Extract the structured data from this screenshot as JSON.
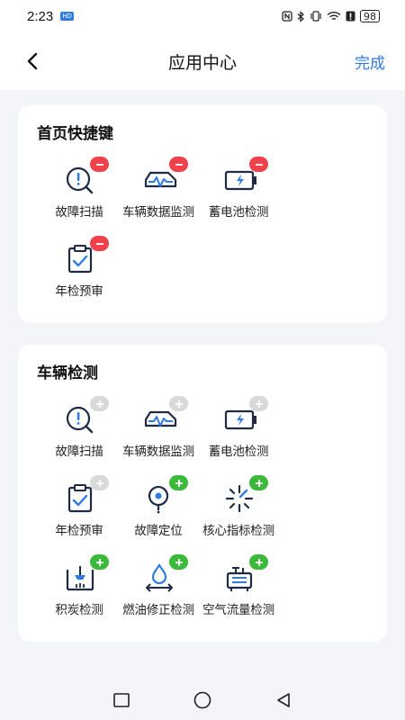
{
  "status_bar": {
    "time": "2:23",
    "hd_badge": "HD",
    "battery": "98"
  },
  "header": {
    "title": "应用中心",
    "done_label": "完成"
  },
  "shortcuts": {
    "title": "首页快捷键",
    "items": [
      {
        "label": "故障扫描",
        "icon": "fault-scan-icon",
        "action": "remove"
      },
      {
        "label": "车辆数据监测",
        "icon": "vehicle-data-icon",
        "action": "remove"
      },
      {
        "label": "蓄电池检测",
        "icon": "battery-test-icon",
        "action": "remove"
      },
      {
        "label": "年检预审",
        "icon": "inspection-icon",
        "action": "remove"
      }
    ]
  },
  "vehicle_test": {
    "title": "车辆检测",
    "items": [
      {
        "label": "故障扫描",
        "icon": "fault-scan-icon",
        "action": "added"
      },
      {
        "label": "车辆数据监测",
        "icon": "vehicle-data-icon",
        "action": "added"
      },
      {
        "label": "蓄电池检测",
        "icon": "battery-test-icon",
        "action": "added"
      },
      {
        "label": "年检预审",
        "icon": "inspection-icon",
        "action": "added"
      },
      {
        "label": "故障定位",
        "icon": "fault-locate-icon",
        "action": "add"
      },
      {
        "label": "核心指标检测",
        "icon": "core-index-icon",
        "action": "add"
      },
      {
        "label": "积炭检测",
        "icon": "carbon-test-icon",
        "action": "add"
      },
      {
        "label": "燃油修正检测",
        "icon": "fuel-trim-icon",
        "action": "add"
      },
      {
        "label": "空气流量检测",
        "icon": "air-flow-icon",
        "action": "add"
      }
    ]
  },
  "colors": {
    "accent": "#2f7be5",
    "remove": "#f0424a",
    "add": "#3bb93a",
    "added": "#d9d9d9"
  }
}
